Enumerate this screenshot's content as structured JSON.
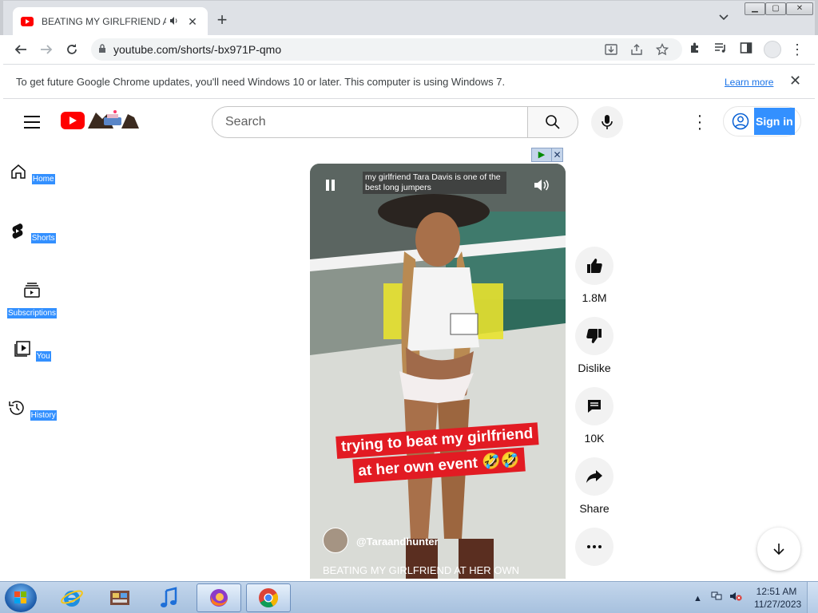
{
  "browser": {
    "tab": {
      "title": "BEATING MY GIRLFRIEND AT",
      "audio_icon": "speaker-icon"
    },
    "url": "youtube.com/shorts/-bx971P-qmo"
  },
  "infobar": {
    "message": "To get future Google Chrome updates, you'll need Windows 10 or later. This computer is using Windows 7.",
    "link": "Learn more"
  },
  "youtube": {
    "search_placeholder": "Search",
    "signin_label": "Sign in",
    "sidebar": [
      {
        "label": "Home",
        "icon": "home-icon"
      },
      {
        "label": "Shorts",
        "icon": "shorts-icon"
      },
      {
        "label": "Subscriptions",
        "icon": "subscriptions-icon"
      },
      {
        "label": "You",
        "icon": "you-icon"
      },
      {
        "label": "History",
        "icon": "history-icon"
      }
    ],
    "short": {
      "description": "my girlfriend Tara Davis is one of the best long jumpers",
      "caption_line1": "trying to beat my girlfriend",
      "caption_line2": "at her own event 🤣🤣",
      "channel": "@Taraandhunter",
      "title": "BEATING MY GIRLFRIEND AT HER OWN"
    },
    "actions": {
      "likes": "1.8M",
      "dislike": "Dislike",
      "comments": "10K",
      "share": "Share"
    }
  },
  "taskbar": {
    "time": "12:51 AM",
    "date": "11/27/2023"
  },
  "colors": {
    "youtube_red": "#ff0000",
    "selection_blue": "#3390ff",
    "caption_red": "#e21b23",
    "taskbar": "#b5cce6"
  }
}
